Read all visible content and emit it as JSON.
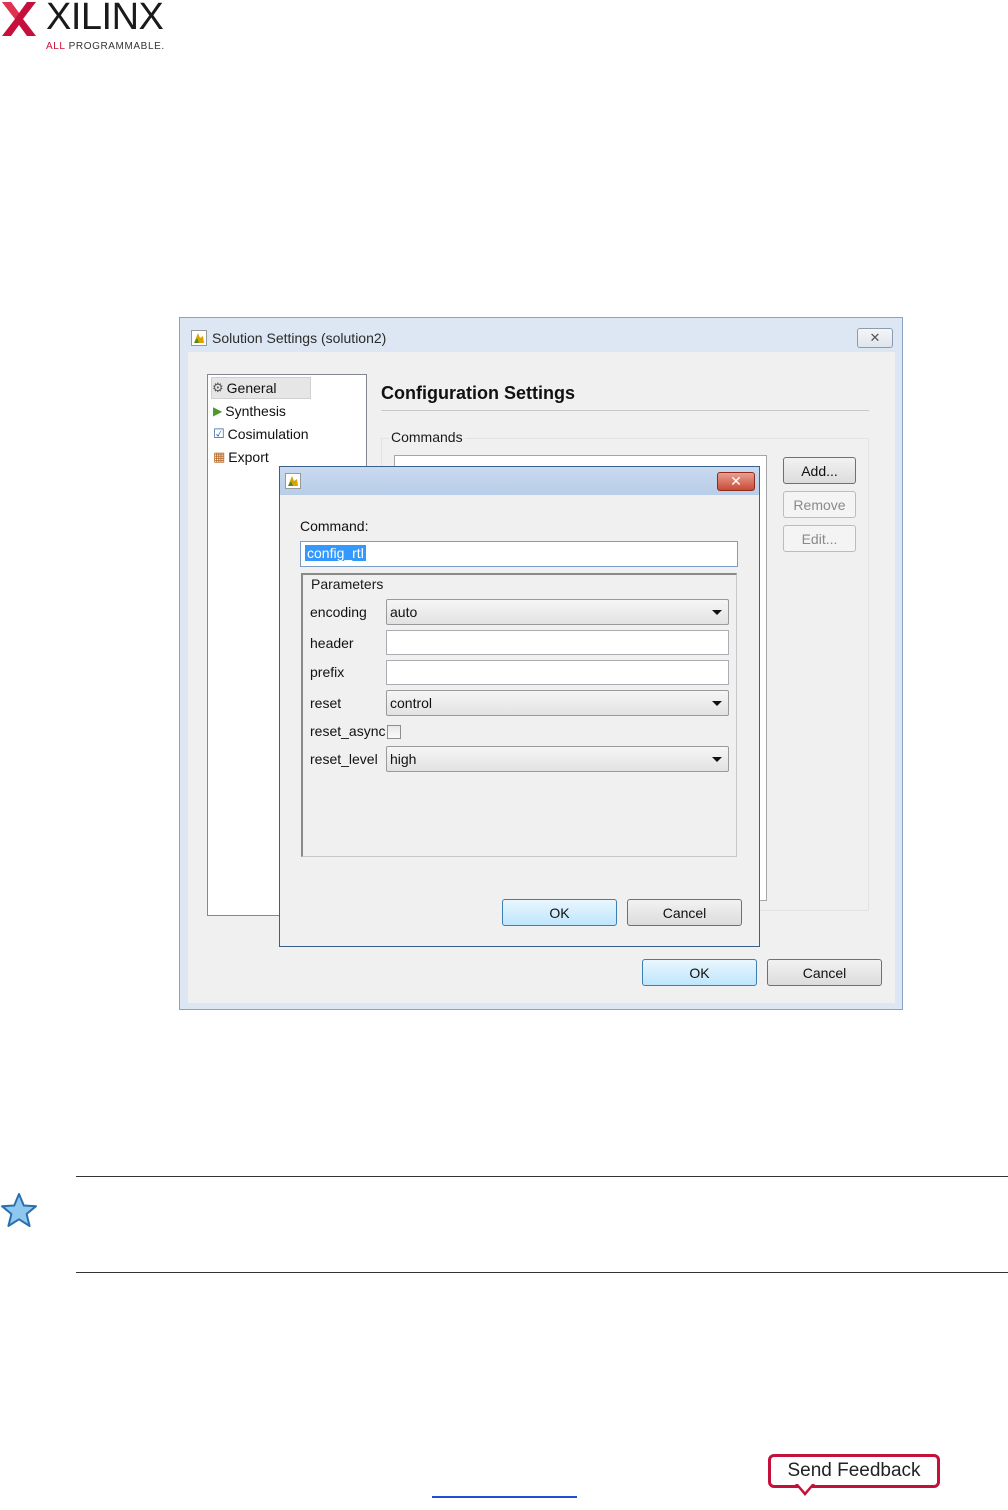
{
  "logo": {
    "word": "XILINX",
    "tagline_prefix": "ALL ",
    "tagline_rest": "PROGRAMMABLE."
  },
  "outer_dialog": {
    "title": "Solution Settings (solution2)",
    "tree": [
      "General",
      "Synthesis",
      "Cosimulation",
      "Export"
    ],
    "heading": "Configuration Settings",
    "commands_label": "Commands",
    "add_label": "Add...",
    "remove_label": "Remove",
    "edit_label": "Edit...",
    "ok_label": "OK",
    "cancel_label": "Cancel"
  },
  "inner_dialog": {
    "command_label": "Command:",
    "command_value": "config_rtl",
    "params_label": "Parameters",
    "params": {
      "encoding": {
        "label": "encoding",
        "value": "auto"
      },
      "header": {
        "label": "header",
        "value": ""
      },
      "prefix": {
        "label": "prefix",
        "value": ""
      },
      "reset": {
        "label": "reset",
        "value": "control"
      },
      "reset_async": {
        "label": "reset_async",
        "checked": false
      },
      "reset_level": {
        "label": "reset_level",
        "value": "high"
      }
    },
    "ok_label": "OK",
    "cancel_label": "Cancel"
  },
  "feedback": {
    "label": "Send Feedback"
  },
  "colors": {
    "brand_red": "#c5103b",
    "selection_blue": "#3399ff",
    "link_blue": "#1f4fd1"
  },
  "icons": [
    "xilinx-logo-icon",
    "app-icon",
    "close-icon",
    "gear-icon",
    "play-icon",
    "checkbox-icon",
    "export-icon",
    "star-icon"
  ]
}
